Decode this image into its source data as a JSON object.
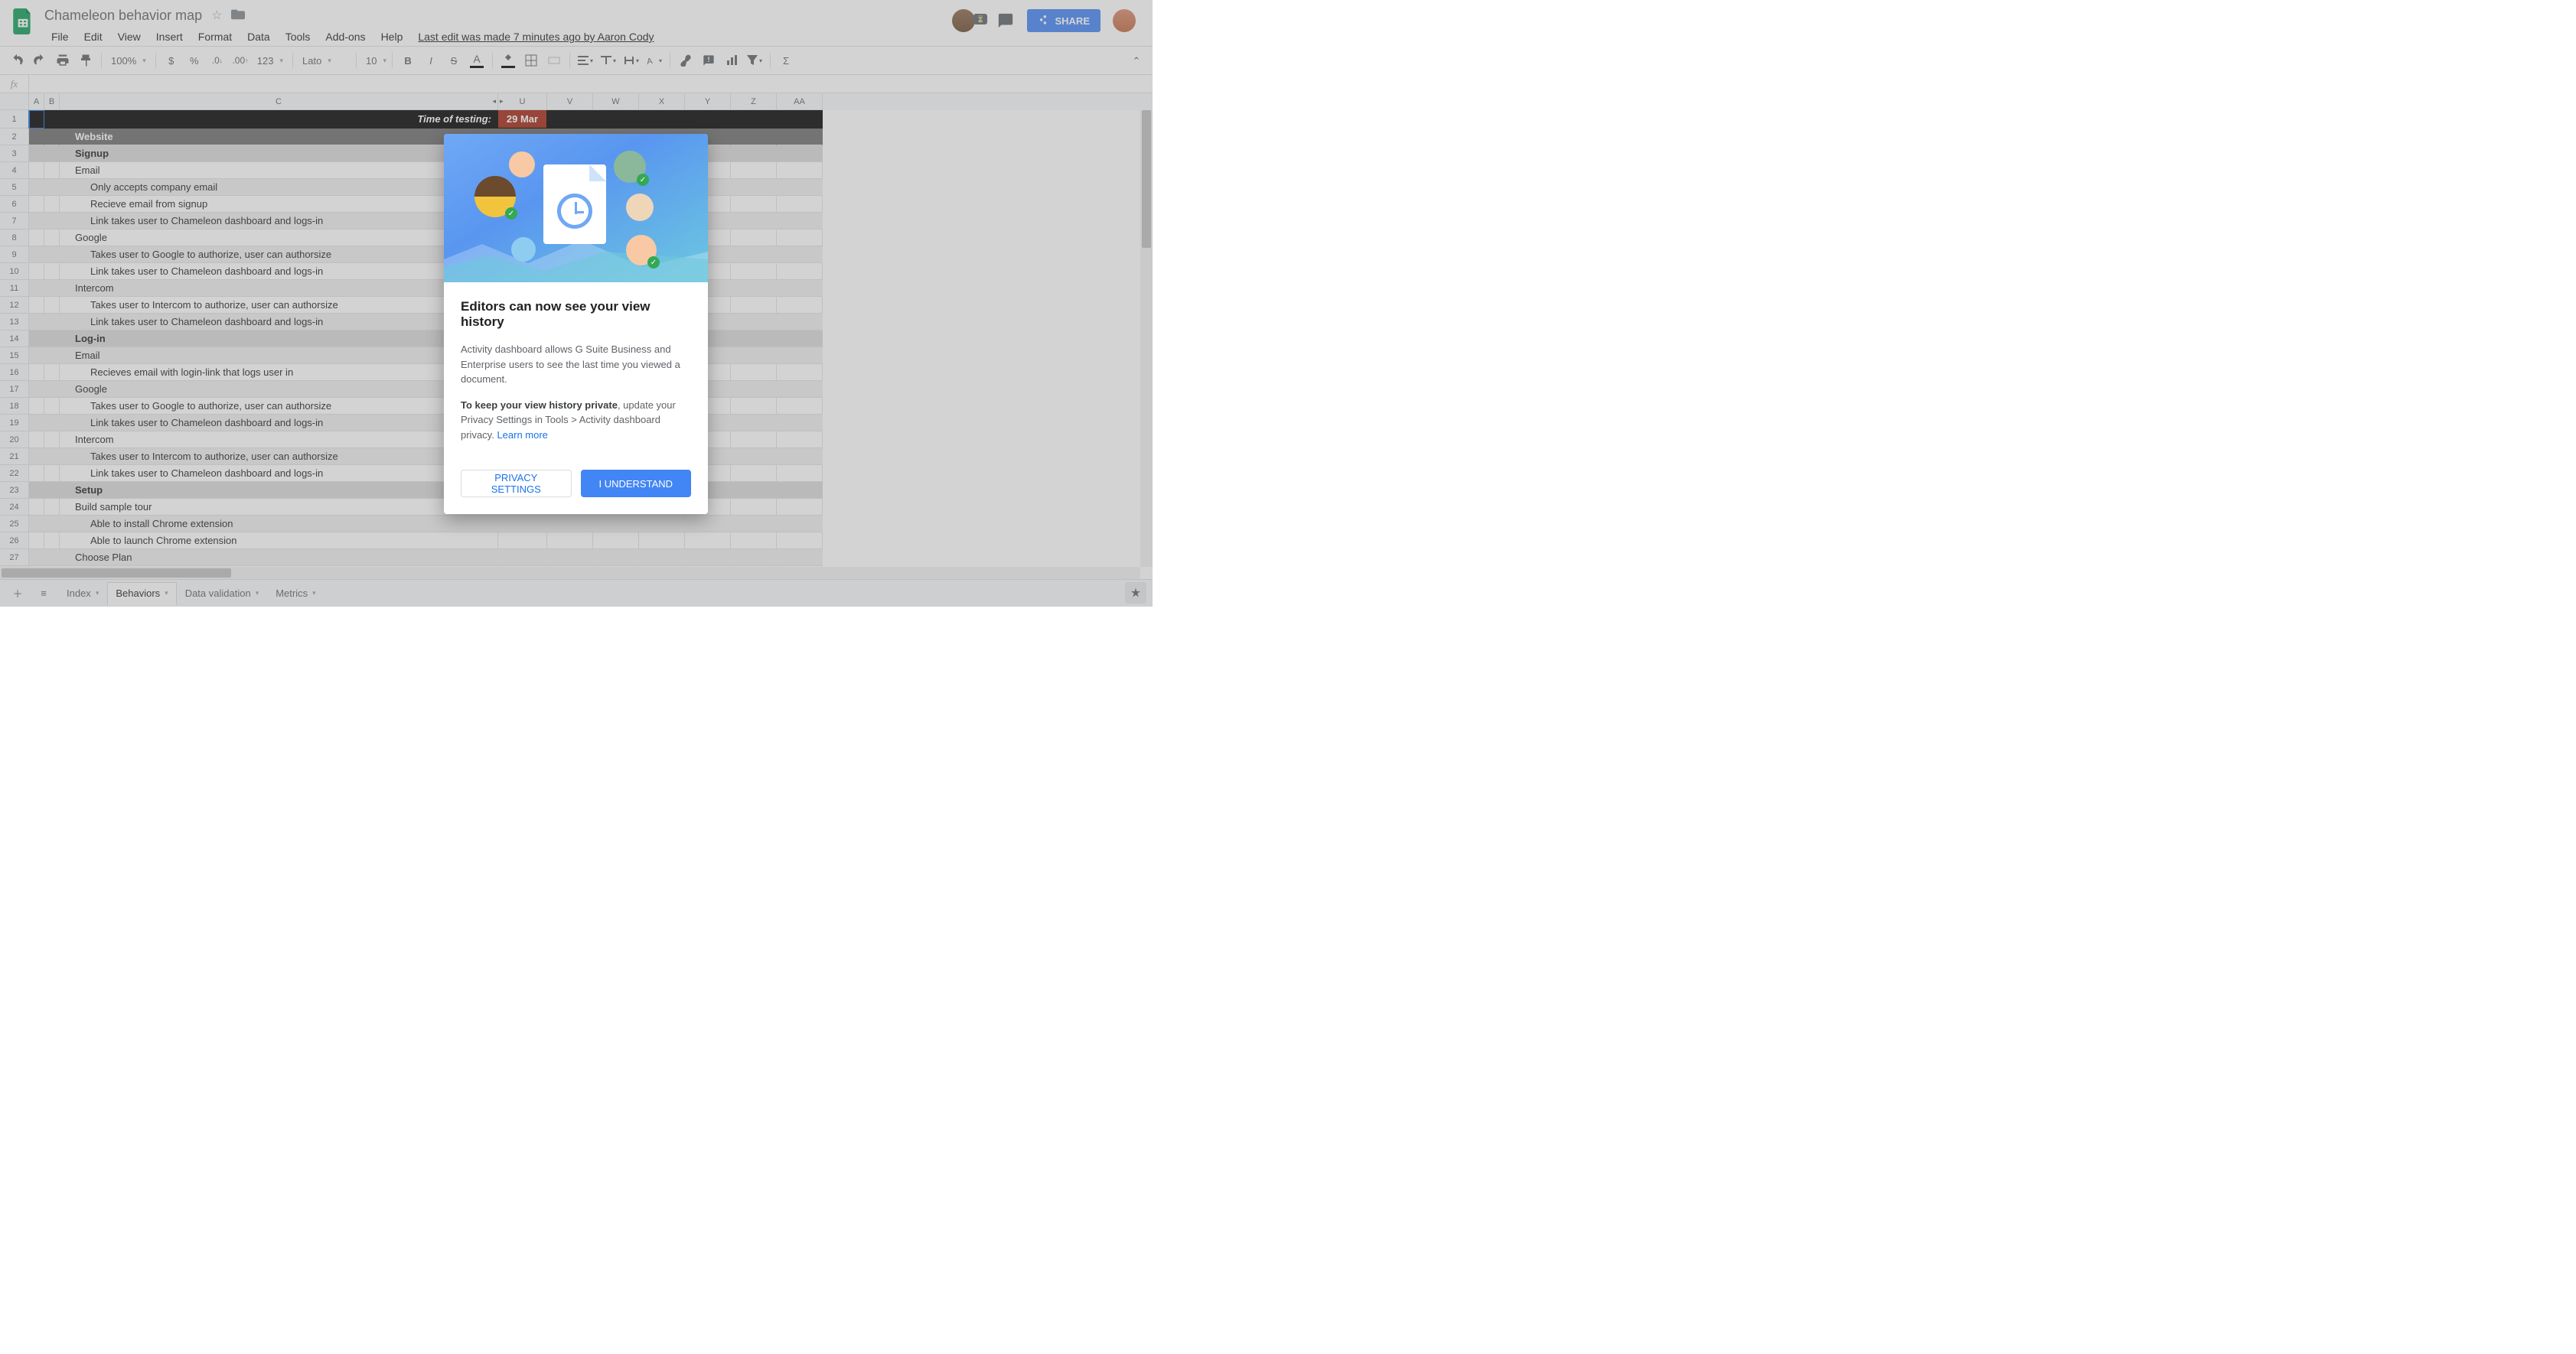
{
  "doc": {
    "title": "Chameleon behavior map",
    "last_edit": "Last edit was made 7 minutes ago by Aaron Cody"
  },
  "menubar": [
    "File",
    "Edit",
    "View",
    "Insert",
    "Format",
    "Data",
    "Tools",
    "Add-ons",
    "Help"
  ],
  "toolbar": {
    "zoom": "100%",
    "num_fmt": "123",
    "font": "Lato",
    "font_size": "10"
  },
  "share": {
    "label": "SHARE"
  },
  "columns": [
    "A",
    "B",
    "C",
    "U",
    "V",
    "W",
    "X",
    "Y",
    "Z",
    "AA"
  ],
  "rows": [
    {
      "n": 1,
      "style": "r-black",
      "c": "Time of testing:",
      "u": "29 Mar"
    },
    {
      "n": 2,
      "style": "r-dgrey",
      "indent": 0,
      "c": "Website"
    },
    {
      "n": 3,
      "style": "r-lgrey",
      "indent": 0,
      "c": "Signup"
    },
    {
      "n": 4,
      "style": "",
      "indent": 0,
      "c": "Email"
    },
    {
      "n": 5,
      "style": "r-stripe",
      "indent": 1,
      "c": "Only accepts company email"
    },
    {
      "n": 6,
      "style": "",
      "indent": 1,
      "c": "Recieve email from signup"
    },
    {
      "n": 7,
      "style": "r-stripe",
      "indent": 1,
      "c": "Link takes user to Chameleon dashboard and logs-in"
    },
    {
      "n": 8,
      "style": "",
      "indent": 0,
      "c": "Google"
    },
    {
      "n": 9,
      "style": "r-stripe",
      "indent": 1,
      "c": "Takes user to Google to authorize, user can authorsize"
    },
    {
      "n": 10,
      "style": "",
      "indent": 1,
      "c": "Link takes user to Chameleon dashboard and logs-in"
    },
    {
      "n": 11,
      "style": "r-stripe",
      "indent": 0,
      "c": "Intercom"
    },
    {
      "n": 12,
      "style": "",
      "indent": 1,
      "c": "Takes user to Intercom to authorize, user can authorsize"
    },
    {
      "n": 13,
      "style": "r-stripe",
      "indent": 1,
      "c": "Link takes user to Chameleon dashboard and logs-in"
    },
    {
      "n": 14,
      "style": "r-lgrey",
      "indent": 0,
      "c": "Log-in"
    },
    {
      "n": 15,
      "style": "r-stripe",
      "indent": 0,
      "c": "Email"
    },
    {
      "n": 16,
      "style": "",
      "indent": 1,
      "c": "Recieves email with login-link that logs user in"
    },
    {
      "n": 17,
      "style": "r-stripe",
      "indent": 0,
      "c": "Google"
    },
    {
      "n": 18,
      "style": "",
      "indent": 1,
      "c": "Takes user to Google to authorize, user can authorsize"
    },
    {
      "n": 19,
      "style": "r-stripe",
      "indent": 1,
      "c": "Link takes user to Chameleon dashboard and logs-in"
    },
    {
      "n": 20,
      "style": "",
      "indent": 0,
      "c": "Intercom"
    },
    {
      "n": 21,
      "style": "r-stripe",
      "indent": 1,
      "c": "Takes user to Intercom to authorize, user can authorsize"
    },
    {
      "n": 22,
      "style": "",
      "indent": 1,
      "c": "Link takes user to Chameleon dashboard and logs-in"
    },
    {
      "n": 23,
      "style": "r-lgrey",
      "indent": 0,
      "c": "Setup"
    },
    {
      "n": 24,
      "style": "",
      "indent": 0,
      "c": "Build sample tour"
    },
    {
      "n": 25,
      "style": "r-stripe",
      "indent": 1,
      "c": "Able to install Chrome extension"
    },
    {
      "n": 26,
      "style": "",
      "indent": 1,
      "c": "Able to launch Chrome extension"
    },
    {
      "n": 27,
      "style": "r-stripe",
      "indent": 0,
      "c": "Choose Plan"
    }
  ],
  "tabs": [
    {
      "label": "Index",
      "active": false
    },
    {
      "label": "Behaviors",
      "active": true
    },
    {
      "label": "Data validation",
      "active": false
    },
    {
      "label": "Metrics",
      "active": false
    }
  ],
  "modal": {
    "title": "Editors can now see your view history",
    "p1": "Activity dashboard allows G Suite Business and Enterprise users to see the last time you viewed a document.",
    "p2_bold": "To keep your view history private",
    "p2_rest": ", update your Privacy Settings in Tools > Activity dashboard privacy. ",
    "learn": "Learn more",
    "btn_sec": "PRIVACY SETTINGS",
    "btn_pri": "I UNDERSTAND"
  }
}
